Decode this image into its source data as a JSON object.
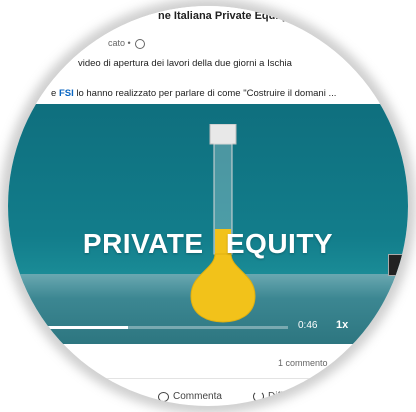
{
  "post": {
    "title": "ne Italiana Private Equity,",
    "meta": "cato •",
    "line1": "video di apertura dei lavori della due giorni a Ischia",
    "line2_prefix": "e",
    "line2_link": "FSI",
    "line2_suffix": "lo hanno realizzato per parlare di come \"Costruire il domani  ..."
  },
  "video": {
    "title_left": "PRIVATE",
    "title_right": "EQUITY",
    "time": "0:46",
    "speed": "1x",
    "progress": 0.43
  },
  "footer": {
    "comment_count": "1 commento",
    "comment_label": "Commenta",
    "share_label": "Diff"
  },
  "icons": {
    "globe": "globe-icon",
    "comment": "comment-icon",
    "share": "share-icon",
    "fullscreen": "fullscreen-icon"
  },
  "colors": {
    "link": "#0a66c2",
    "video_bg": "#127d8b",
    "liquid": "#f2c21a"
  }
}
